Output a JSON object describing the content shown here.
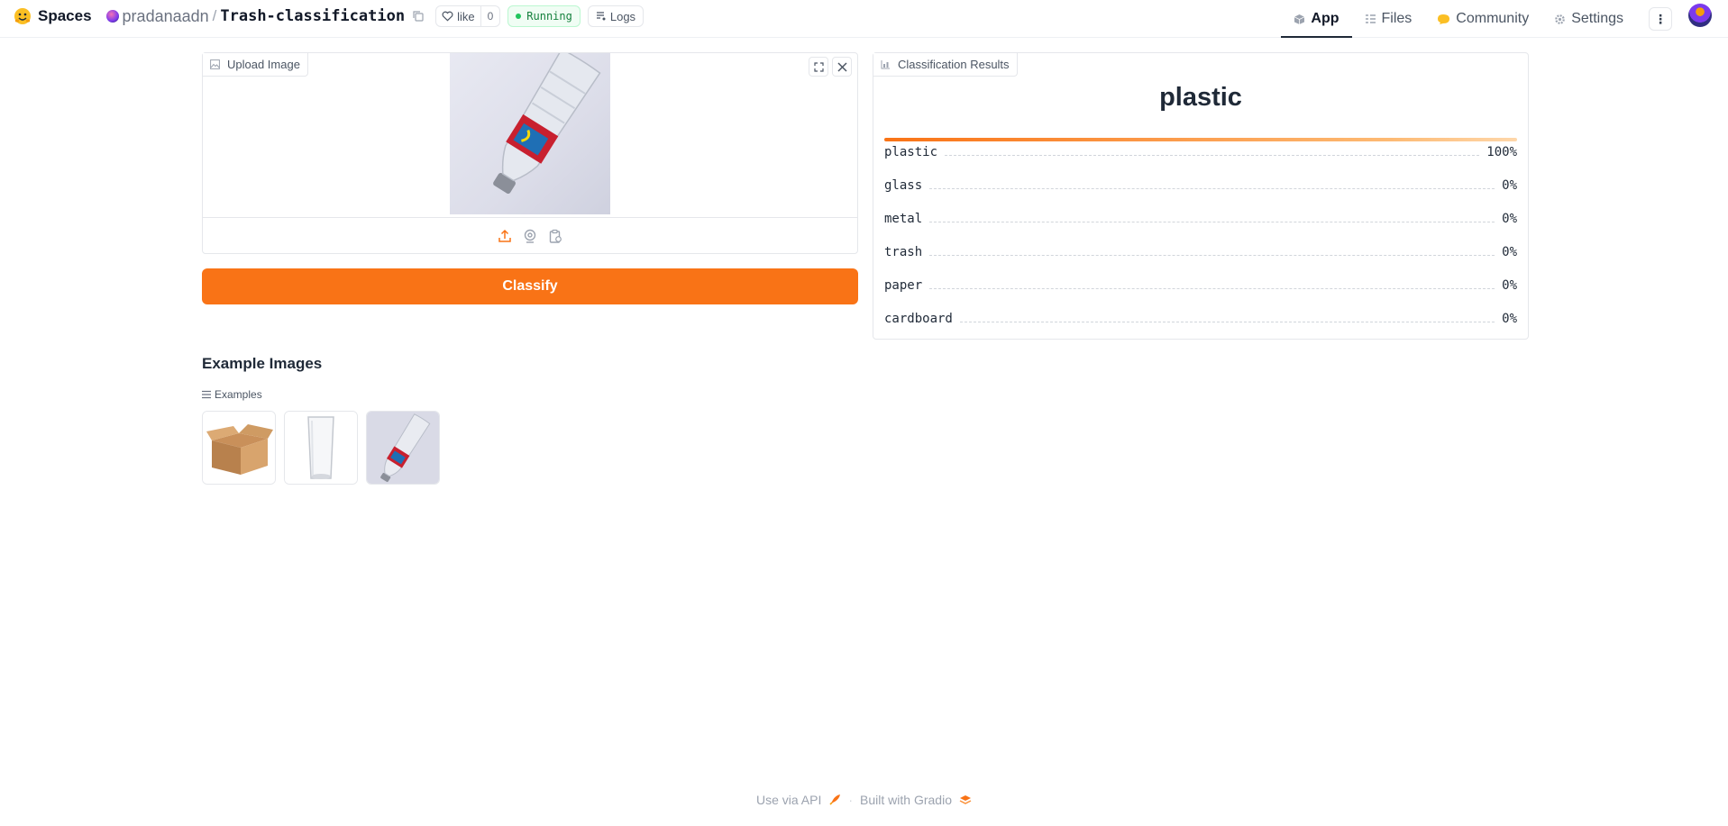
{
  "header": {
    "spaces_label": "Spaces",
    "owner": "pradanaadn",
    "repo": "Trash-classification",
    "like_label": "like",
    "like_count": "0",
    "status": "Running",
    "logs_label": "Logs",
    "nav": [
      {
        "label": "App",
        "icon": "cube-icon",
        "active": true
      },
      {
        "label": "Files",
        "icon": "files-icon",
        "active": false
      },
      {
        "label": "Community",
        "icon": "community-icon",
        "active": false
      },
      {
        "label": "Settings",
        "icon": "gear-icon",
        "active": false
      }
    ]
  },
  "upload": {
    "label": "Upload Image"
  },
  "classify_label": "Classify",
  "results": {
    "label": "Classification Results",
    "top_label": "plastic",
    "items": [
      {
        "label": "plastic",
        "percent": "100%",
        "value": 1.0
      },
      {
        "label": "glass",
        "percent": "0%",
        "value": 0
      },
      {
        "label": "metal",
        "percent": "0%",
        "value": 0
      },
      {
        "label": "trash",
        "percent": "0%",
        "value": 0
      },
      {
        "label": "paper",
        "percent": "0%",
        "value": 0
      },
      {
        "label": "cardboard",
        "percent": "0%",
        "value": 0
      }
    ]
  },
  "examples": {
    "heading": "Example Images",
    "label": "Examples",
    "items": [
      "cardboard-box-image",
      "glass-image",
      "plastic-bottle-image"
    ]
  },
  "footer": {
    "api_label": "Use via API",
    "separator": "·",
    "built_label": "Built with Gradio"
  },
  "colors": {
    "accent": "#f97316",
    "status_green": "#22c55e"
  }
}
